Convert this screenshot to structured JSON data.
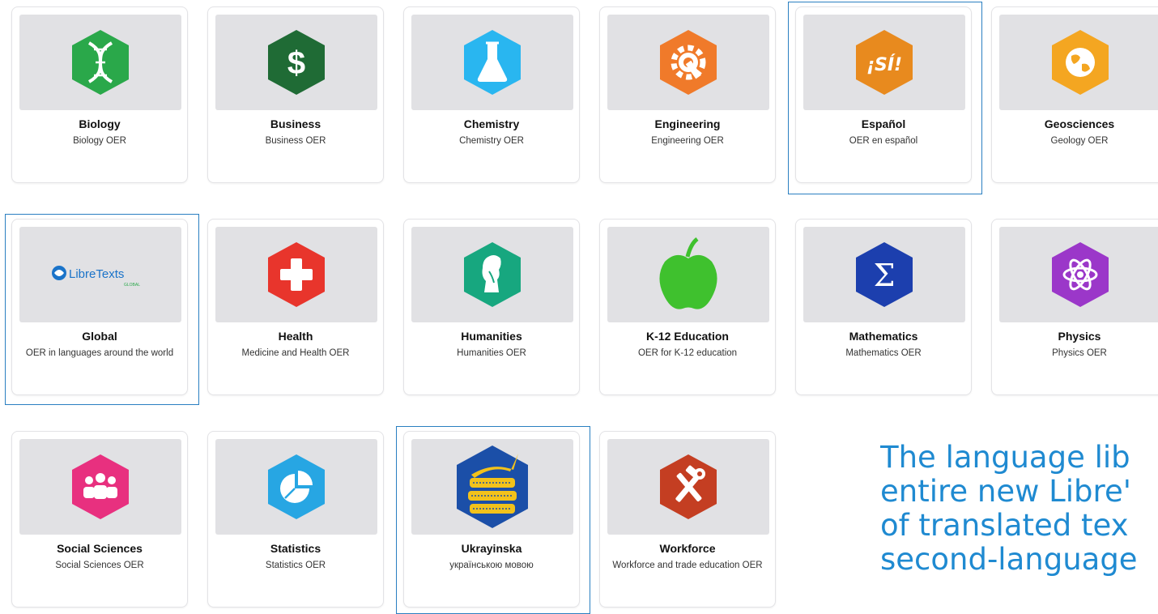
{
  "libraries": [
    {
      "key": "biology",
      "title": "Biology",
      "subtitle": "Biology OER",
      "icon": "dna-icon"
    },
    {
      "key": "business",
      "title": "Business",
      "subtitle": "Business OER",
      "icon": "dollar-sign-icon"
    },
    {
      "key": "chemistry",
      "title": "Chemistry",
      "subtitle": "Chemistry OER",
      "icon": "flask-icon"
    },
    {
      "key": "engineering",
      "title": "Engineering",
      "subtitle": "Engineering OER",
      "icon": "gear-wrench-icon"
    },
    {
      "key": "espanol",
      "title": "Español",
      "subtitle": "OER en español",
      "icon": "si-text-icon",
      "icon_text": "¡SÍ!"
    },
    {
      "key": "geosciences",
      "title": "Geosciences",
      "subtitle": "Geology OER",
      "icon": "globe-icon"
    },
    {
      "key": "global",
      "title": "Global",
      "subtitle": "OER in languages around the world",
      "icon": "libretexts-global-logo",
      "logo_text": "LibreTexts",
      "logo_subtext": "GLOBAL"
    },
    {
      "key": "health",
      "title": "Health",
      "subtitle": "Medicine and Health OER",
      "icon": "medical-cross-icon"
    },
    {
      "key": "humanities",
      "title": "Humanities",
      "subtitle": "Humanities OER",
      "icon": "philosopher-bust-icon"
    },
    {
      "key": "k12",
      "title": "K-12 Education",
      "subtitle": "OER for K-12 education",
      "icon": "apple-icon"
    },
    {
      "key": "mathematics",
      "title": "Mathematics",
      "subtitle": "Mathematics OER",
      "icon": "sigma-icon",
      "icon_text": "Σ"
    },
    {
      "key": "physics",
      "title": "Physics",
      "subtitle": "Physics OER",
      "icon": "atom-icon"
    },
    {
      "key": "social",
      "title": "Social Sciences",
      "subtitle": "Social Sciences OER",
      "icon": "people-group-icon"
    },
    {
      "key": "statistics",
      "title": "Statistics",
      "subtitle": "Statistics OER",
      "icon": "pie-chart-icon"
    },
    {
      "key": "ukrayinska",
      "title": "Ukrayinska",
      "subtitle": "українською мовою",
      "icon": "books-speech-icon"
    },
    {
      "key": "workforce",
      "title": "Workforce",
      "subtitle": "Workforce and trade education OER",
      "icon": "hammer-wrench-icon"
    }
  ],
  "caption_lines": [
    "The language lib",
    "entire new Libre'",
    "of translated tex",
    "second-language"
  ],
  "colors": {
    "highlight": "#2a7fc1",
    "caption": "#1f8ad1",
    "biology": "#2aa84a",
    "business": "#1f6b35",
    "chemistry": "#29b6f0",
    "engineering": "#f07a2a",
    "espanol": "#e88a1e",
    "geosciences": "#f4a621",
    "health": "#e8352c",
    "humanities": "#17a77f",
    "k12": "#3fc12e",
    "mathematics": "#1c3fae",
    "physics": "#9b37c9",
    "social": "#e8307f",
    "statistics": "#27a6e3",
    "ukrayinska": "#1b4fa8",
    "workforce": "#c43e22"
  }
}
